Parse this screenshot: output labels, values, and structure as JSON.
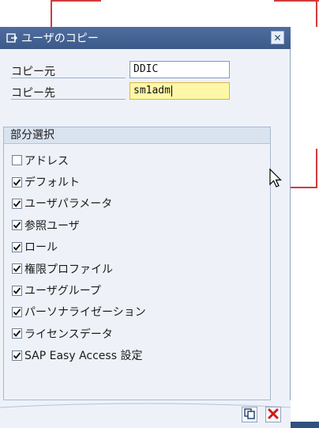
{
  "dialog": {
    "title": "ユーザのコピー"
  },
  "fields": {
    "source": {
      "label": "コピー元",
      "value": "DDIC"
    },
    "target": {
      "label": "コピー先",
      "value": "sm1adm"
    }
  },
  "group": {
    "title": "部分選択",
    "items": [
      {
        "label": "アドレス",
        "checked": false
      },
      {
        "label": "デフォルト",
        "checked": true
      },
      {
        "label": "ユーザパラメータ",
        "checked": true
      },
      {
        "label": "参照ユーザ",
        "checked": true
      },
      {
        "label": "ロール",
        "checked": true
      },
      {
        "label": "権限プロファイル",
        "checked": true
      },
      {
        "label": "ユーザグループ",
        "checked": true
      },
      {
        "label": "パーソナライゼーション",
        "checked": true
      },
      {
        "label": "ライセンスデータ",
        "checked": true
      },
      {
        "label": "SAP Easy Access 設定",
        "checked": true
      }
    ]
  },
  "footer": {
    "buttons": [
      {
        "icon": "copy-icon"
      },
      {
        "icon": "cancel-icon"
      }
    ]
  },
  "colors": {
    "title_bar": "#3b5a8a",
    "dialog_bg": "#eef2f8",
    "active_input": "#fff7a8",
    "cancel_red": "#d11a1a",
    "annotation_red": "#d23b3b"
  }
}
